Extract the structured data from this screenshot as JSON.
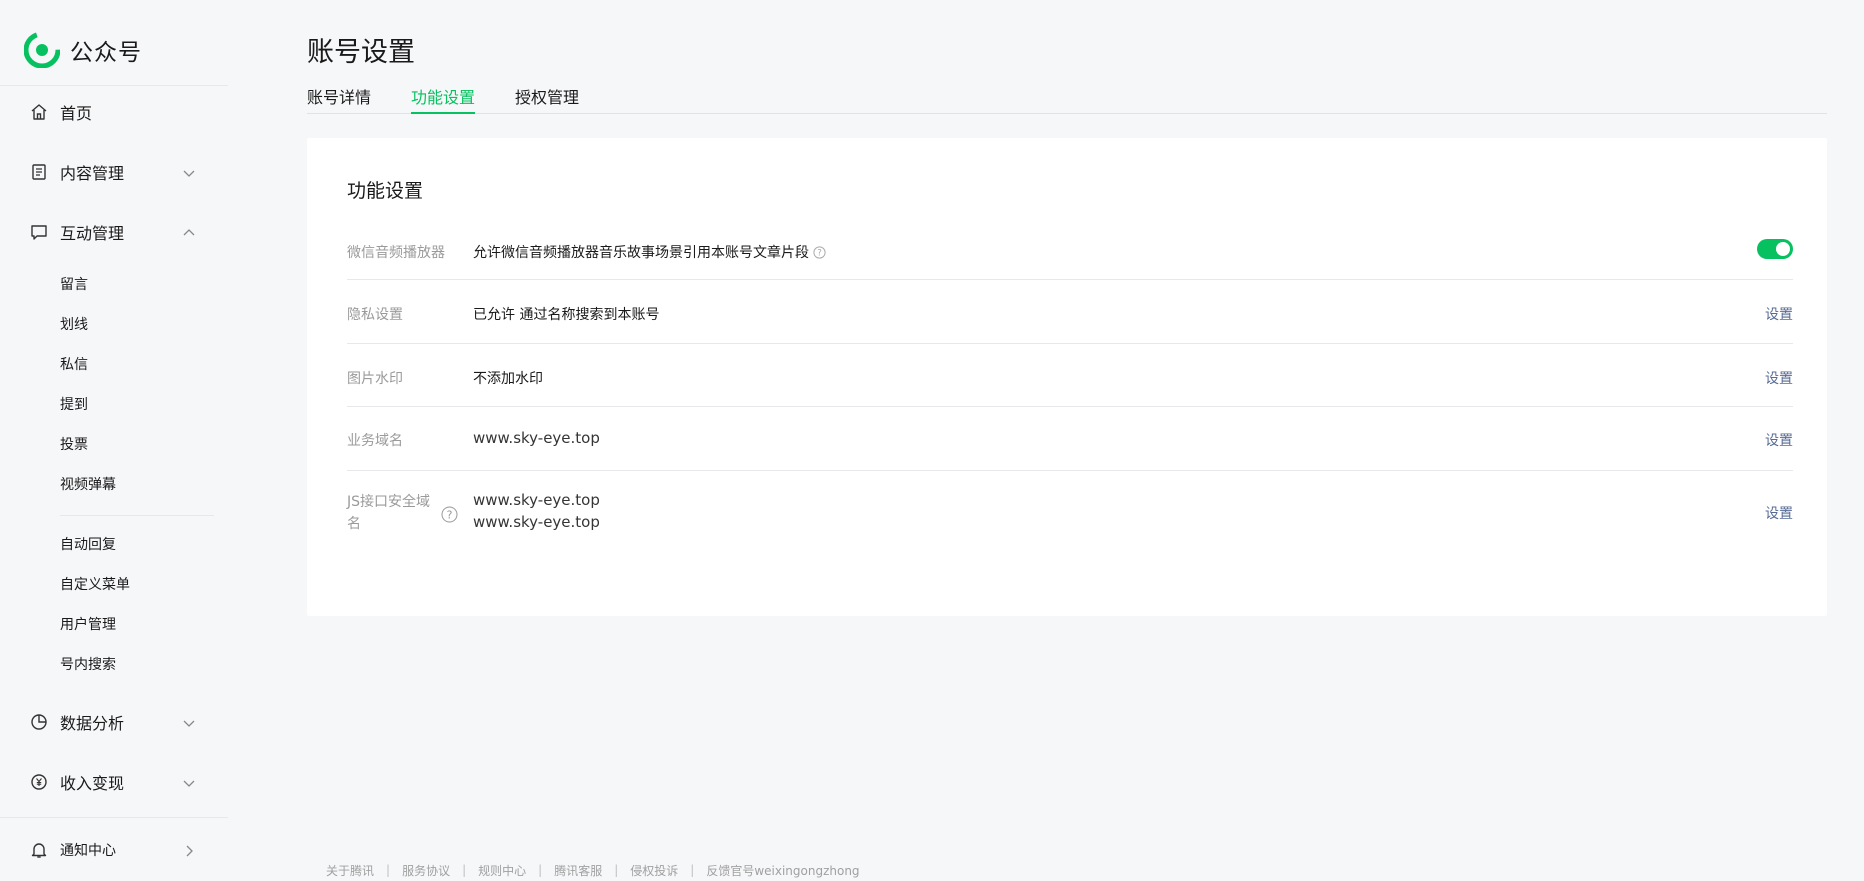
{
  "app": {
    "logo_text": "公众号"
  },
  "sidebar": {
    "home": "首页",
    "content_mgmt": "内容管理",
    "interaction_mgmt": "互动管理",
    "interaction_items": [
      "留言",
      "划线",
      "私信",
      "提到",
      "投票",
      "视频弹幕"
    ],
    "service_items": [
      "自动回复",
      "自定义菜单",
      "用户管理",
      "号内搜索"
    ],
    "data_analysis": "数据分析",
    "revenue": "收入变现",
    "notifications": "通知中心"
  },
  "page": {
    "title": "账号设置",
    "tabs": [
      "账号详情",
      "功能设置",
      "授权管理"
    ],
    "active_tab": "功能设置"
  },
  "panel": {
    "title": "功能设置",
    "rows": [
      {
        "label": "微信音频播放器",
        "value": "允许微信音频播放器音乐故事场景引用本账号文章片段",
        "toggle_on": true
      },
      {
        "label": "隐私设置",
        "value": "已允许 通过名称搜索到本账号",
        "action": "设置"
      },
      {
        "label": "图片水印",
        "value": "不添加水印",
        "action": "设置"
      },
      {
        "label": "业务域名",
        "value": "www.sky-eye.top",
        "action": "设置"
      },
      {
        "label": "JS接口安全域名",
        "values": [
          "www.sky-eye.top",
          "www.sky-eye.top"
        ],
        "action": "设置"
      }
    ]
  },
  "footer": {
    "links": [
      "关于腾讯",
      "服务协议",
      "规则中心",
      "腾讯客服",
      "侵权投诉",
      "反馈官号weixingongzhong"
    ],
    "separator": "|"
  },
  "colors": {
    "accent": "#07c160",
    "link": "#576b95",
    "background": "#f6f7f9"
  }
}
